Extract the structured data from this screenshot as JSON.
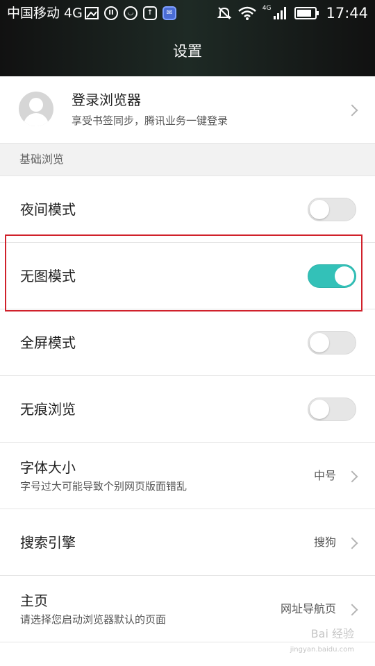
{
  "status_bar": {
    "carrier": "中国移动 4G",
    "network": "4G",
    "time": "17:44",
    "icons": [
      "image-icon",
      "pause-icon",
      "face-icon",
      "usb-icon",
      "app-icon",
      "mute-icon",
      "wifi-icon",
      "signal-icon",
      "battery-icon"
    ]
  },
  "header": {
    "title": "设置"
  },
  "account": {
    "title": "登录浏览器",
    "subtitle": "享受书签同步，腾讯业务一键登录"
  },
  "section": {
    "label": "基础浏览"
  },
  "settings": [
    {
      "label": "夜间模式",
      "type": "toggle",
      "enabled": false
    },
    {
      "label": "无图模式",
      "type": "toggle",
      "enabled": true
    },
    {
      "label": "全屏模式",
      "type": "toggle",
      "enabled": false
    },
    {
      "label": "无痕浏览",
      "type": "toggle",
      "enabled": false
    },
    {
      "label": "字体大小",
      "subtitle": "字号过大可能导致个别网页版面错乱",
      "value": "中号",
      "type": "link"
    },
    {
      "label": "搜索引擎",
      "value": "搜狗",
      "type": "link"
    },
    {
      "label": "主页",
      "subtitle": "请选择您启动浏览器默认的页面",
      "value": "网址导航页",
      "type": "link"
    }
  ],
  "colors": {
    "accent": "#33c1b8",
    "highlight": "#d0212b"
  },
  "watermark": {
    "text": "Bai 经验",
    "url": "jingyan.baidu.com"
  }
}
